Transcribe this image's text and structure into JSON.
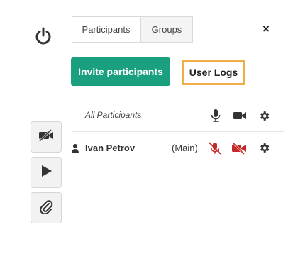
{
  "tabs": [
    {
      "label": "Participants",
      "active": true
    },
    {
      "label": "Groups",
      "active": false
    }
  ],
  "actions": {
    "invite_label": "Invite participants",
    "user_logs_label": "User Logs"
  },
  "participants_header": {
    "label": "All Participants"
  },
  "participants": [
    {
      "name": "Ivan Petrov",
      "tag": "(Main)",
      "mic_muted": true,
      "camera_off": true
    }
  ],
  "icons": {
    "power": "power-icon",
    "camera_off": "camera-off-icon",
    "play": "play-icon",
    "attach": "paperclip-icon",
    "close": "close-icon",
    "mic": "microphone-icon",
    "camera": "video-camera-icon",
    "settings": "gear-icon",
    "user": "user-icon"
  },
  "colors": {
    "invite_button": "#1aa07f",
    "user_logs_highlight": "#f2ae46",
    "muted": "#c62828",
    "icon_dark": "#333333"
  },
  "close_symbol": "×"
}
